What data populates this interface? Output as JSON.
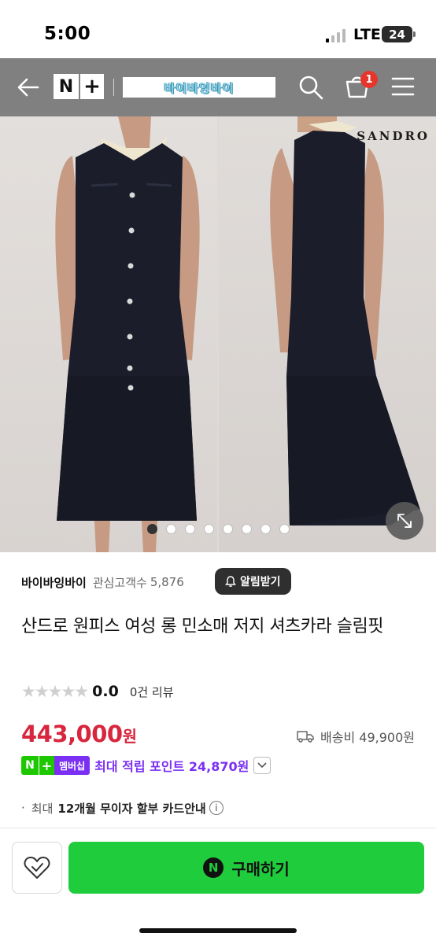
{
  "status_bar": {
    "time": "5:00",
    "network": "LTE",
    "battery": "24"
  },
  "navbar": {
    "logo_n": "N",
    "logo_plus": "+",
    "store_banner": "바이바잉바이",
    "cart_count": "1"
  },
  "gallery": {
    "brand_watermark": "SANDRO",
    "total_images": 8,
    "active_index": 0
  },
  "seller": {
    "name": "바이바잉바이",
    "interest_label": "관심고객수",
    "interest_count": "5,876",
    "alarm_button": "알림받기"
  },
  "product": {
    "title": "산드로 원피스 여성 롱 민소매 저지 셔츠카라 슬림핏",
    "rating": "0.0",
    "review_count": "0건 리뷰",
    "price": "443,000",
    "price_unit": "원",
    "shipping": "배송비 49,900원"
  },
  "membership": {
    "badge_n": "N",
    "badge_plus": "+",
    "badge_label": "멤버십",
    "points_text": "최대 적립 포인트 24,870원"
  },
  "installment": {
    "bullet": "·",
    "prefix": "최대",
    "text": "12개월 무이자 할부 카드안내",
    "info": "i"
  },
  "bottom_bar": {
    "buy_icon": "N",
    "buy_label": "구매하기"
  },
  "colors": {
    "navbar_bg": "#808080",
    "price_red": "#d7263d",
    "member_purple": "#7a2ff2",
    "buy_green": "#1fcc3c",
    "badge_red": "#e5362b"
  }
}
